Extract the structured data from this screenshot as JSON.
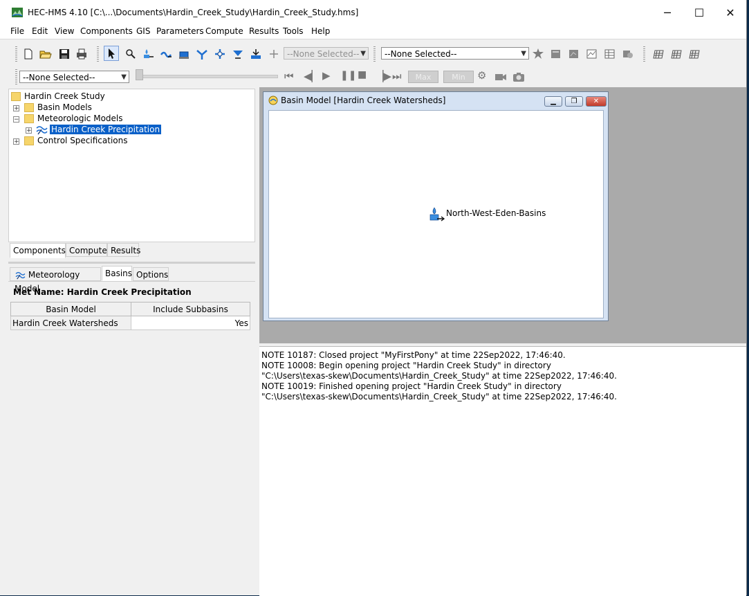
{
  "window": {
    "title": "HEC-HMS 4.10 [C:\\...\\Documents\\Hardin_Creek_Study\\Hardin_Creek_Study.hms]",
    "minimize": "─",
    "maximize": "☐",
    "close": "✕"
  },
  "menu": [
    "File",
    "Edit",
    "View",
    "Components",
    "GIS",
    "Parameters",
    "Compute",
    "Results",
    "Tools",
    "Help"
  ],
  "toolbar": {
    "element_combo": "--None Selected--",
    "run_combo": "--None Selected--",
    "time_combo": "--None Selected--",
    "max_label": "Max",
    "min_label": "Min"
  },
  "tree": {
    "root": "Hardin Creek Study",
    "items": [
      {
        "label": "Basin Models",
        "expander": "+"
      },
      {
        "label": "Meteorologic Models",
        "expander": "−"
      },
      {
        "label": "Hardin Creek Precipitation",
        "expander": "+",
        "selected": true
      },
      {
        "label": "Control Specifications",
        "expander": "+"
      }
    ]
  },
  "explorer_tabs": [
    "Components",
    "Compute",
    "Results"
  ],
  "component_tabs": [
    "Meteorology Model",
    "Basins",
    "Options"
  ],
  "properties": {
    "met_name": "Met Name: Hardin Creek Precipitation",
    "columns": [
      "Basin Model",
      "Include Subbasins"
    ],
    "rows": [
      {
        "basin": "Hardin Creek Watersheds",
        "include": "Yes"
      }
    ]
  },
  "basin_window": {
    "title": "Basin Model [Hardin Creek Watersheds]",
    "element_label": "North-West-Eden-Basins"
  },
  "log": [
    "NOTE 10187:  Closed project \"MyFirstPony\" at time 22Sep2022, 17:46:40.",
    "NOTE 10008:  Begin opening project \"Hardin Creek Study\" in directory",
    "\"C:\\Users\\texas-skew\\Documents\\Hardin_Creek_Study\" at time 22Sep2022, 17:46:40.",
    "NOTE 10019:  Finished opening project \"Hardin Creek Study\" in directory",
    "\"C:\\Users\\texas-skew\\Documents\\Hardin_Creek_Study\" at time 22Sep2022, 17:46:40."
  ]
}
